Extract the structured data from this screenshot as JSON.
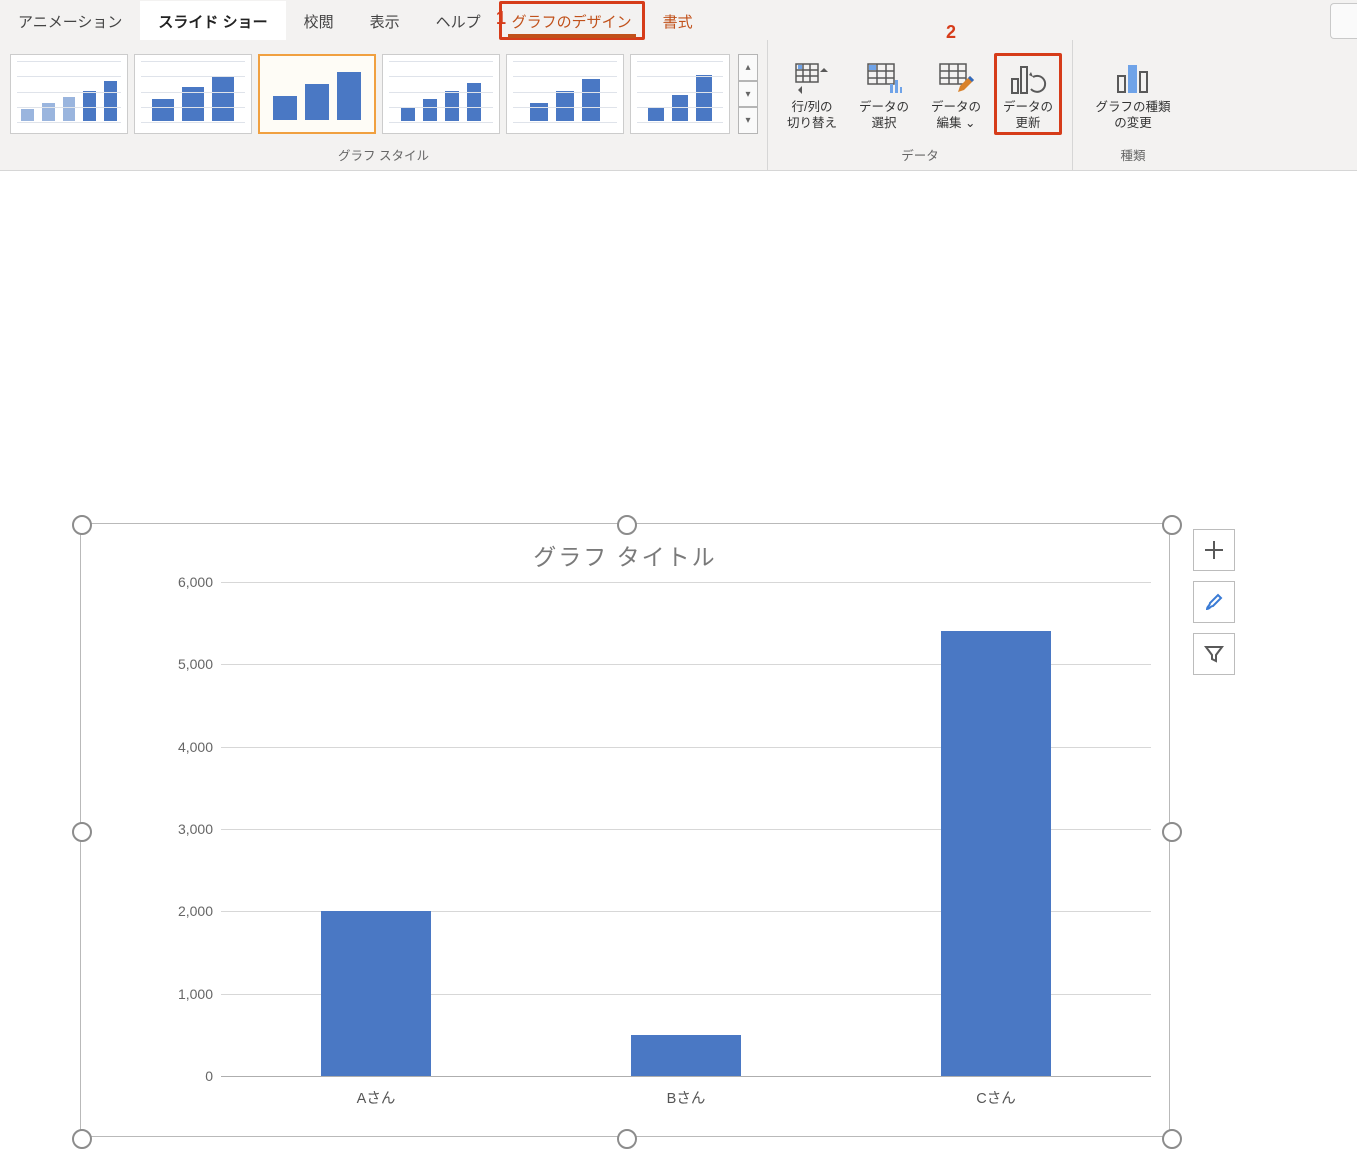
{
  "tabs": {
    "animation": "アニメーション",
    "slideshow": "スライド ショー",
    "review": "校閲",
    "view": "表示",
    "help": "ヘルプ",
    "chartDesign": "グラフのデザイン",
    "format": "書式"
  },
  "annotations": {
    "one": "1",
    "two": "2"
  },
  "ribbon": {
    "groups": {
      "styles": "グラフ スタイル",
      "data": "データ",
      "type": "種類"
    },
    "buttons": {
      "switchRowCol": "行/列の\n切り替え",
      "selectData": "データの\n選択",
      "editData": "データの\n編集",
      "refreshData": "データの\n更新",
      "changeType": "グラフの種類\nの変更"
    },
    "editDataCaret": "⌄"
  },
  "chart": {
    "title": "グラフ タイトル"
  },
  "chart_data": {
    "type": "bar",
    "title": "グラフ タイトル",
    "categories": [
      "Aさん",
      "Bさん",
      "Cさん"
    ],
    "values": [
      2000,
      500,
      5400
    ],
    "ylabel": "",
    "xlabel": "",
    "ylim": [
      0,
      6000
    ],
    "yticks": [
      0,
      1000,
      2000,
      3000,
      4000,
      5000,
      6000
    ],
    "yticklabels": [
      "0",
      "1,000",
      "2,000",
      "3,000",
      "4,000",
      "5,000",
      "6,000"
    ]
  },
  "colors": {
    "accent": "#4a78c4",
    "highlight": "#d63c1a"
  }
}
